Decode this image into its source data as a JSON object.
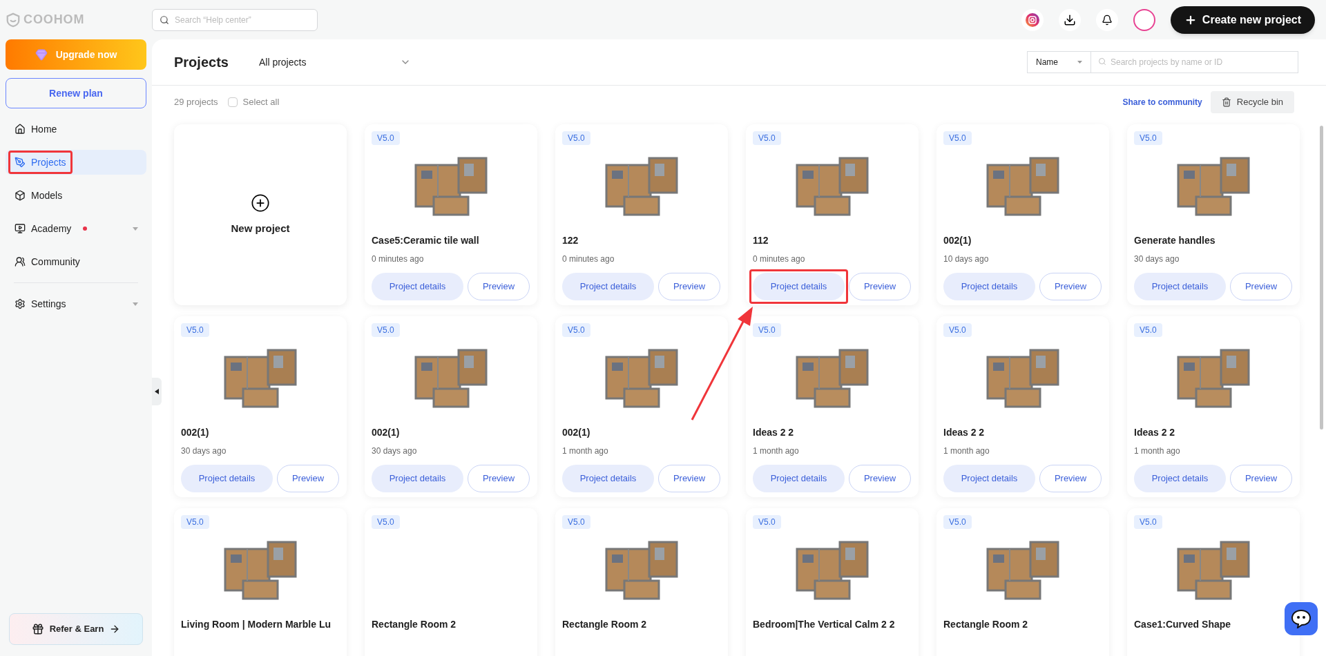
{
  "brand": {
    "name": "COOHOM"
  },
  "help_search": {
    "placeholder": "Search “Help center”"
  },
  "create_button": {
    "label": "Create new project"
  },
  "sidebar": {
    "upgrade": "Upgrade now",
    "renew": "Renew plan",
    "items": [
      {
        "label": "Home",
        "selected": false,
        "dot": false,
        "expandable": false,
        "highlighted": false
      },
      {
        "label": "Projects",
        "selected": true,
        "dot": false,
        "expandable": false,
        "highlighted": true
      },
      {
        "label": "Models",
        "selected": false,
        "dot": false,
        "expandable": false,
        "highlighted": false
      },
      {
        "label": "Academy",
        "selected": false,
        "dot": true,
        "expandable": true,
        "highlighted": false
      },
      {
        "label": "Community",
        "selected": false,
        "dot": false,
        "expandable": false,
        "highlighted": false
      }
    ],
    "lower_items": [
      {
        "label": "Settings",
        "selected": false,
        "dot": false,
        "expandable": true,
        "highlighted": false
      }
    ],
    "refer": "Refer & Earn"
  },
  "page": {
    "title": "Projects",
    "filter": "All projects",
    "sort": "Name",
    "search_placeholder": "Search projects by name or ID",
    "count": "29 projects",
    "select_all": {
      "label": "Select all",
      "checked": false
    },
    "share": "Share to community",
    "recycle": "Recycle bin"
  },
  "new_project": {
    "label": "New project"
  },
  "projects": [
    {
      "badge": "V5.0",
      "title": "Case5:Ceramic tile wall",
      "time": "0 minutes ago",
      "thumbnail": true,
      "buttons": [
        "Project details",
        "Preview"
      ],
      "highlighted": false
    },
    {
      "badge": "V5.0",
      "title": "122",
      "time": "0 minutes ago",
      "thumbnail": true,
      "buttons": [
        "Project details",
        "Preview"
      ],
      "highlighted": false
    },
    {
      "badge": "V5.0",
      "title": "112",
      "time": "0 minutes ago",
      "thumbnail": true,
      "buttons": [
        "Project details",
        "Preview"
      ],
      "highlighted": true
    },
    {
      "badge": "V5.0",
      "title": "002(1)",
      "time": "10 days ago",
      "thumbnail": true,
      "buttons": [
        "Project details",
        "Preview"
      ],
      "highlighted": false
    },
    {
      "badge": "V5.0",
      "title": "Generate handles",
      "time": "30 days ago",
      "thumbnail": true,
      "buttons": [
        "Project details",
        "Preview"
      ],
      "highlighted": false
    },
    {
      "badge": "V5.0",
      "title": "002(1)",
      "time": "30 days ago",
      "thumbnail": true,
      "buttons": [
        "Project details",
        "Preview"
      ],
      "highlighted": false
    },
    {
      "badge": "V5.0",
      "title": "002(1)",
      "time": "30 days ago",
      "thumbnail": true,
      "buttons": [
        "Project details",
        "Preview"
      ],
      "highlighted": false
    },
    {
      "badge": "V5.0",
      "title": "002(1)",
      "time": "1 month ago",
      "thumbnail": true,
      "buttons": [
        "Project details",
        "Preview"
      ],
      "highlighted": false
    },
    {
      "badge": "V5.0",
      "title": "Ideas 2 2",
      "time": "1 month ago",
      "thumbnail": true,
      "buttons": [
        "Project details",
        "Preview"
      ],
      "highlighted": false
    },
    {
      "badge": "V5.0",
      "title": "Ideas 2 2",
      "time": "1 month ago",
      "thumbnail": true,
      "buttons": [
        "Project details",
        "Preview"
      ],
      "highlighted": false
    },
    {
      "badge": "V5.0",
      "title": "Ideas 2 2",
      "time": "1 month ago",
      "thumbnail": true,
      "buttons": [
        "Project details",
        "Preview"
      ],
      "highlighted": false
    },
    {
      "badge": "V5.0",
      "title": "Living Room | Modern Marble Lu",
      "thumbnail": true,
      "highlighted": false
    },
    {
      "badge": "V5.0",
      "title": "Rectangle Room 2",
      "thumbnail": false,
      "highlighted": false
    },
    {
      "badge": "V5.0",
      "title": "Rectangle Room 2",
      "thumbnail": true,
      "highlighted": false
    },
    {
      "badge": "V5.0",
      "title": "Bedroom|The Vertical Calm 2 2",
      "thumbnail": true,
      "highlighted": false
    },
    {
      "badge": "V5.0",
      "title": "Rectangle Room 2",
      "thumbnail": true,
      "highlighted": false
    },
    {
      "badge": "V5.0",
      "title": "Case1:Curved Shape",
      "thumbnail": true,
      "highlighted": false
    }
  ]
}
